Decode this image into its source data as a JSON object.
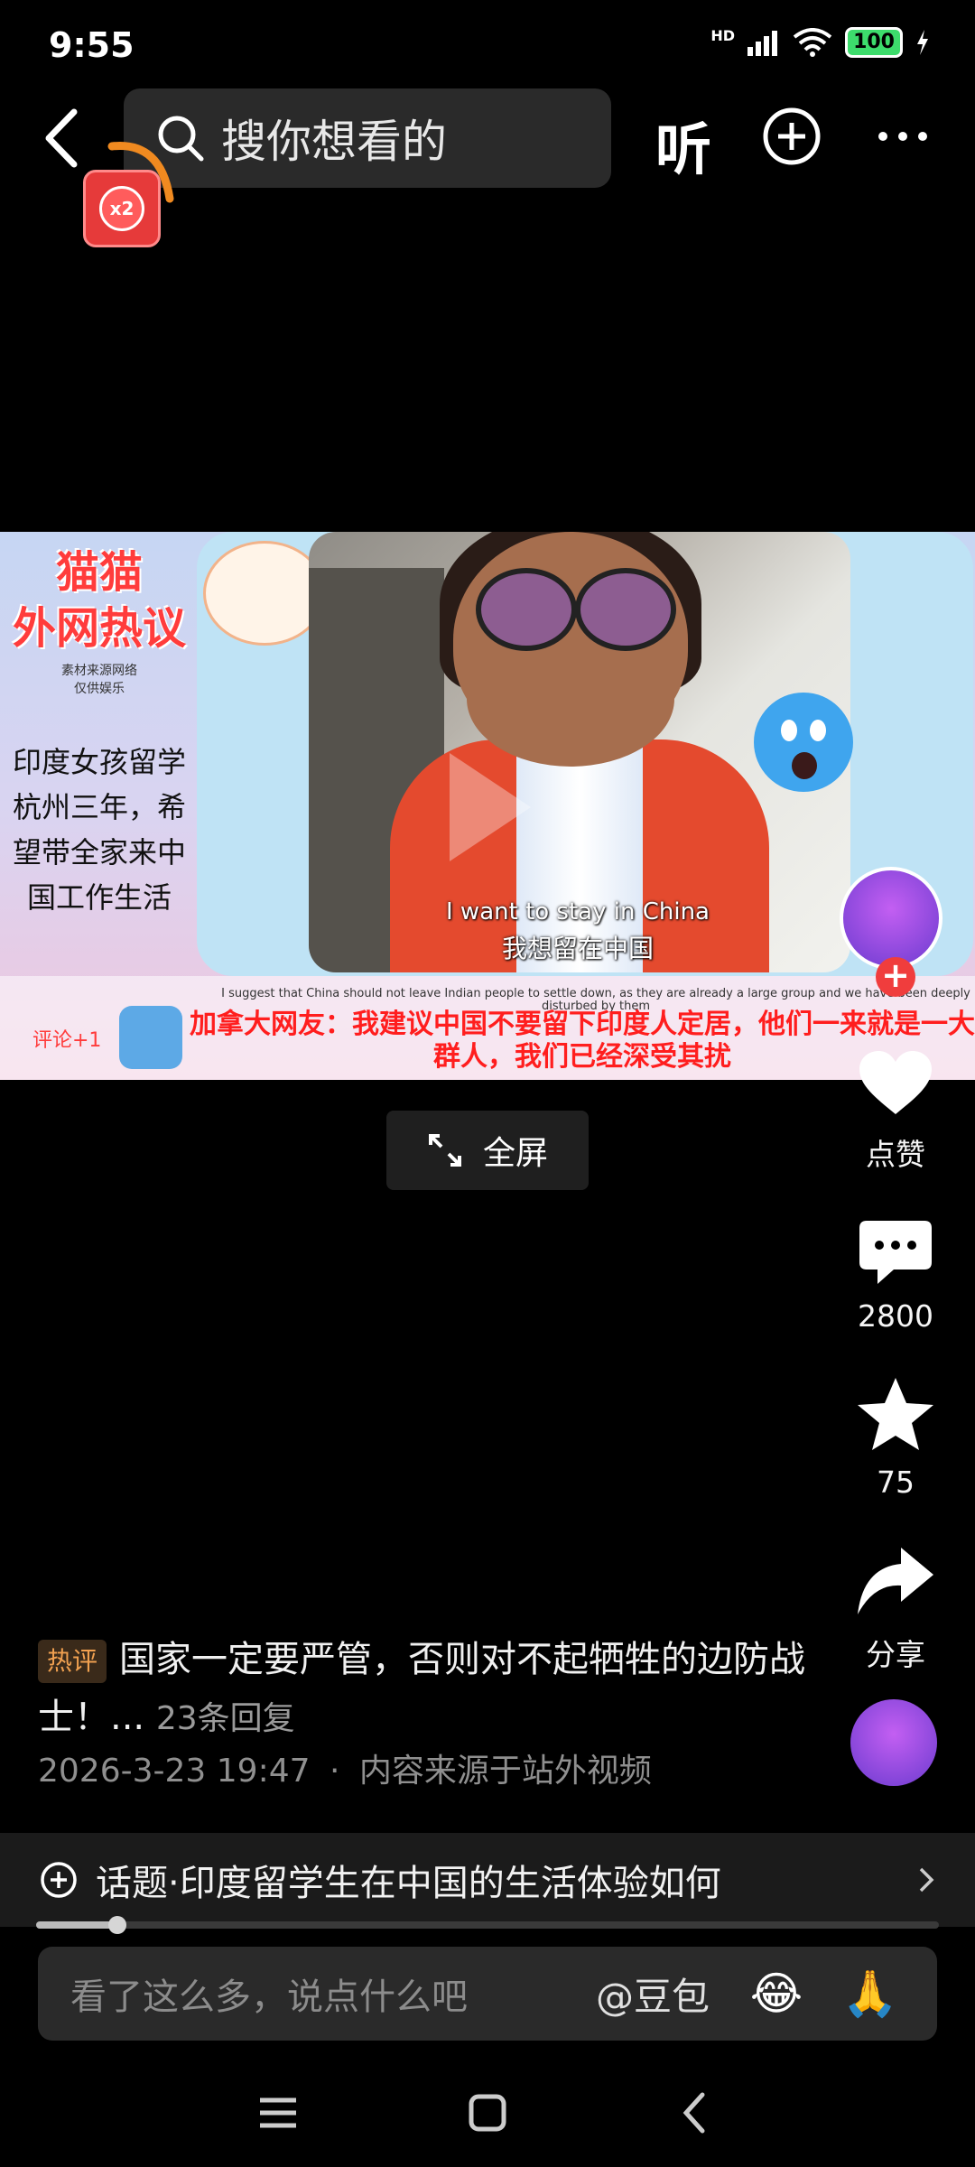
{
  "status_bar": {
    "time": "9:55",
    "network": "HD",
    "battery": "100"
  },
  "top_nav": {
    "search_placeholder": "搜你想看的",
    "listen_label": "听",
    "redpack_badge": "x2"
  },
  "video": {
    "channel_title_line1": "猫猫",
    "channel_title_line2": "外网热议",
    "source_note_line1": "素材来源网络",
    "source_note_line2": "仅供娱乐",
    "story_text": "印度女孩留学杭州三年，希望带全家来中国工作生活",
    "subtitle_en": "I want to stay in China",
    "subtitle_zh": "我想留在中国",
    "comment_en": "I suggest that China should not leave Indian people to settle down, as they are already a large group and we have been deeply disturbed by them",
    "comment_zh": "加拿大网友：我建议中国不要留下印度人定居，他们一来就是一大群人，我们已经深受其扰",
    "comment_tag": "评论+1"
  },
  "fullscreen_label": "全屏",
  "actions": {
    "like_label": "点赞",
    "comment_count": "2800",
    "favorite_count": "75",
    "share_label": "分享"
  },
  "hot_comment": {
    "tag": "热评",
    "text": "国家一定要严管，否则对不起牺牲的边防战士！...",
    "reply_count": "23条回复"
  },
  "meta": {
    "datetime": "2026-3-23 19:47",
    "separator": "·",
    "source": "内容来源于站外视频"
  },
  "topic": {
    "label": "话题·印度留学生在中国的生活体验如何"
  },
  "playback": {
    "progress_fraction": 0.09
  },
  "input_bar": {
    "placeholder": "看了这么多，说点什么吧",
    "mention": "@豆包"
  },
  "colors": {
    "background": "#000000",
    "accent_red": "#f03d3d",
    "hot_tag": "#f0a050"
  }
}
